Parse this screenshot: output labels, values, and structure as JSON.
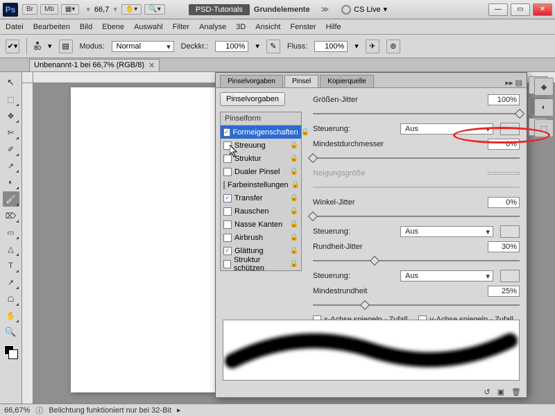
{
  "app": {
    "icon": "Ps",
    "launcher_badges": [
      "Br",
      "Mb"
    ],
    "zoom_title": "66,7",
    "title_pill": "PSD-Tutorials",
    "title_plain": "Grundelemente",
    "cslive": "CS Live"
  },
  "menu": [
    "Datei",
    "Bearbeiten",
    "Bild",
    "Ebene",
    "Auswahl",
    "Filter",
    "Analyse",
    "3D",
    "Ansicht",
    "Fenster",
    "Hilfe"
  ],
  "options": {
    "brush_size": "80",
    "mode_label": "Modus:",
    "mode_value": "Normal",
    "opacity_label": "Deckkr.:",
    "opacity_value": "100%",
    "flow_label": "Fluss:",
    "flow_value": "100%"
  },
  "doc_tab": "Unbenannt-1 bei 66,7% (RGB/8)",
  "status": {
    "zoom": "66,67%",
    "msg": "Belichtung funktioniert nur bei 32-Bit"
  },
  "panel": {
    "tabs": [
      "Pinselvorgaben",
      "Pinsel",
      "Kopierquelle"
    ],
    "preset_btn": "Pinselvorgaben",
    "list_header": "Pinselform",
    "items": [
      {
        "label": "Formeigenschaften",
        "checked": true,
        "selected": true
      },
      {
        "label": "Streuung",
        "checked": false
      },
      {
        "label": "Struktur",
        "checked": false
      },
      {
        "label": "Dualer Pinsel",
        "checked": false
      },
      {
        "label": "Farbeinstellungen",
        "checked": false
      },
      {
        "label": "Transfer",
        "checked": true
      },
      {
        "label": "Rauschen",
        "checked": false
      },
      {
        "label": "Nasse Kanten",
        "checked": false
      },
      {
        "label": "Airbrush",
        "checked": false
      },
      {
        "label": "Glättung",
        "checked": true
      },
      {
        "label": "Struktur schützen",
        "checked": false
      }
    ],
    "right": {
      "size_jitter_lbl": "Größen-Jitter",
      "size_jitter_val": "100%",
      "control_lbl": "Steuerung:",
      "control_val": "Aus",
      "min_diam_lbl": "Mindestdurchmesser",
      "min_diam_val": "0%",
      "tilt_lbl": "Neigungsgröße",
      "angle_jitter_lbl": "Winkel-Jitter",
      "angle_jitter_val": "0%",
      "control2_val": "Aus",
      "round_jitter_lbl": "Rundheit-Jitter",
      "round_jitter_val": "30%",
      "control3_val": "Aus",
      "min_round_lbl": "Mindestrundheit",
      "min_round_val": "25%",
      "flip_x": "x-Achse spiegeln - Zufall",
      "flip_y": "y-Achse spiegeln - Zufall"
    }
  },
  "tools": [
    "↖",
    "⬚",
    "✥",
    "✄",
    "✐",
    "↗",
    "◐",
    "🖌",
    "⌦",
    "▭",
    "△",
    "T",
    "↗",
    "☖",
    "✋",
    "🔍"
  ],
  "dock": [
    "◧",
    "❏",
    "◆",
    "⬚",
    "✎",
    "⬚"
  ]
}
